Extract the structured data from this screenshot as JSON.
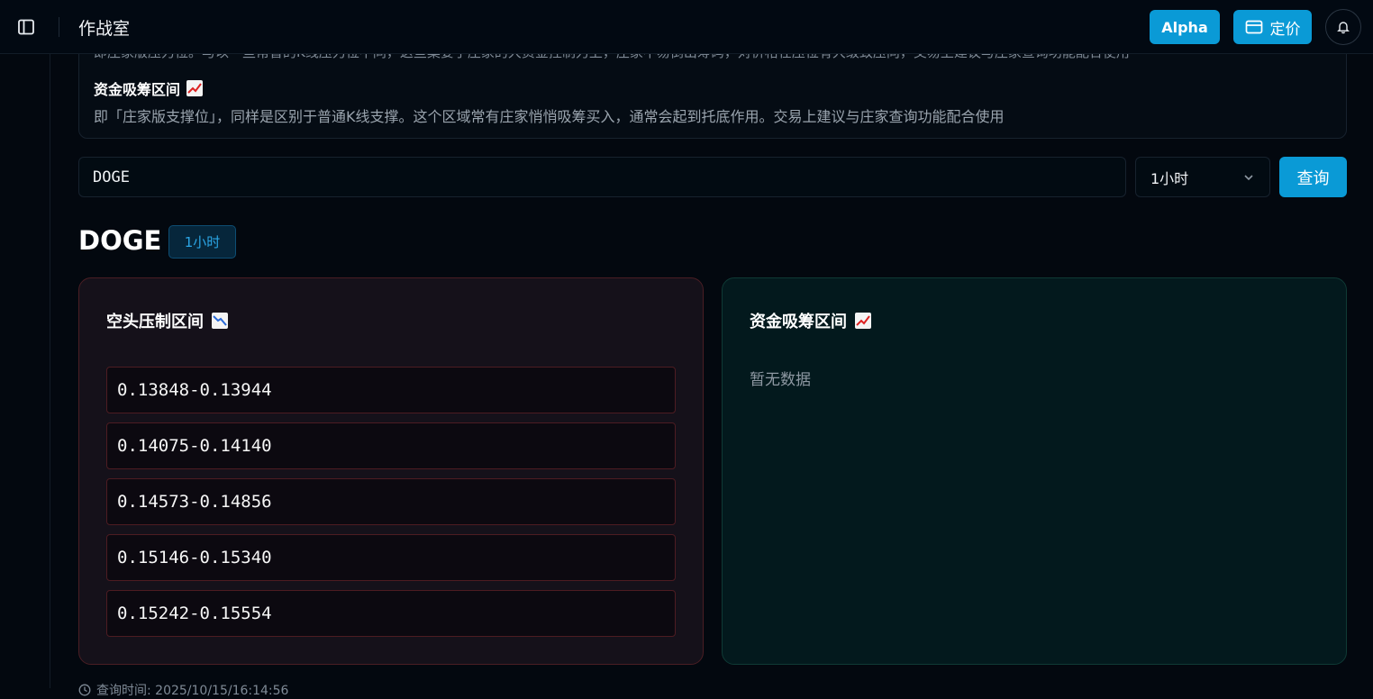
{
  "header": {
    "title": "作战室",
    "alpha_label": "Alpha",
    "pricing_label": "定价"
  },
  "info": {
    "cut_text": "即庄家版压力位。与以一些常普的K线压力位不同，这些案要于庄家的大资金控制力上，庄家不易倒出筹码，对价格在压位有大级致压向，交易上建议与庄家查询功能配合使用",
    "heading": "资金吸筹区间",
    "text": "即「庄家版支撑位」，同样是区别于普通K线支撑。这个区域常有庄家悄悄吸筹买入，通常会起到托底作用。交易上建议与庄家查询功能配合使用"
  },
  "search": {
    "value": "DOGE",
    "interval_selected": "1小时",
    "query_label": "查询"
  },
  "result": {
    "symbol": "DOGE",
    "interval_badge": "1小时"
  },
  "bear_panel": {
    "title": "空头压制区间",
    "ranges": [
      "0.13848-0.13944",
      "0.14075-0.14140",
      "0.14573-0.14856",
      "0.15146-0.15340",
      "0.15242-0.15554"
    ]
  },
  "bull_panel": {
    "title": "资金吸筹区间",
    "empty_text": "暂无数据"
  },
  "footer": {
    "query_time": "查询时间: 2025/10/15/16:14:56"
  },
  "colors": {
    "accent": "#0a9ad6",
    "bear_border": "#4a1e24",
    "bull_bg": "#03191d"
  }
}
